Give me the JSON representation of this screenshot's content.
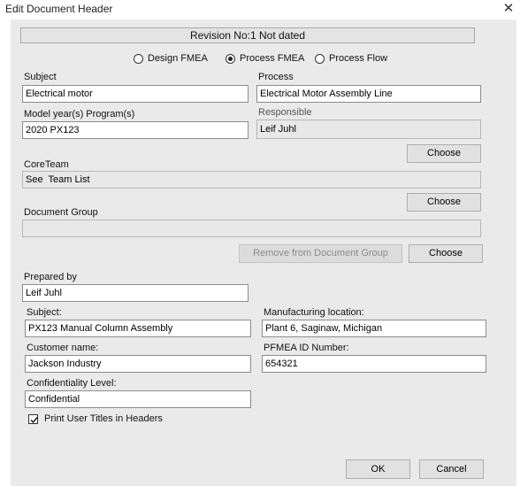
{
  "window": {
    "title": "Edit Document Header",
    "close_glyph": "✕"
  },
  "revision": "Revision No:1  Not dated",
  "fmea_type": {
    "options": [
      "Design FMEA",
      "Process FMEA",
      "Process Flow"
    ],
    "selected": "Process FMEA"
  },
  "subject": {
    "label": "Subject",
    "value": "Electrical motor"
  },
  "process": {
    "label": "Process",
    "value": "Electrical Motor Assembly Line"
  },
  "model_year": {
    "label": "Model year(s) Program(s)",
    "value": "2020 PX123"
  },
  "responsible": {
    "label": "Responsible",
    "value": "Leif Juhl"
  },
  "core_team": {
    "label": "CoreTeam",
    "value": "See  Team List"
  },
  "document_group": {
    "label": "Document Group",
    "value": ""
  },
  "buttons": {
    "choose": "Choose",
    "remove_from_group": "Remove from Document Group",
    "ok": "OK",
    "cancel": "Cancel"
  },
  "prepared_by": {
    "label": "Prepared by",
    "value": "Leif Juhl"
  },
  "user_subject": {
    "label": "Subject:",
    "value": "PX123 Manual Column Assembly"
  },
  "manufacturing_location": {
    "label": "Manufacturing location:",
    "value": "Plant 6, Saginaw, Michigan"
  },
  "customer_name": {
    "label": "Customer name:",
    "value": "Jackson Industry"
  },
  "pfmea_id": {
    "label": "PFMEA ID Number:",
    "value": "654321"
  },
  "confidentiality": {
    "label": "Confidentiality Level:",
    "value": "Confidential"
  },
  "print_titles": {
    "label": "Print User Titles in Headers",
    "checked": true
  }
}
